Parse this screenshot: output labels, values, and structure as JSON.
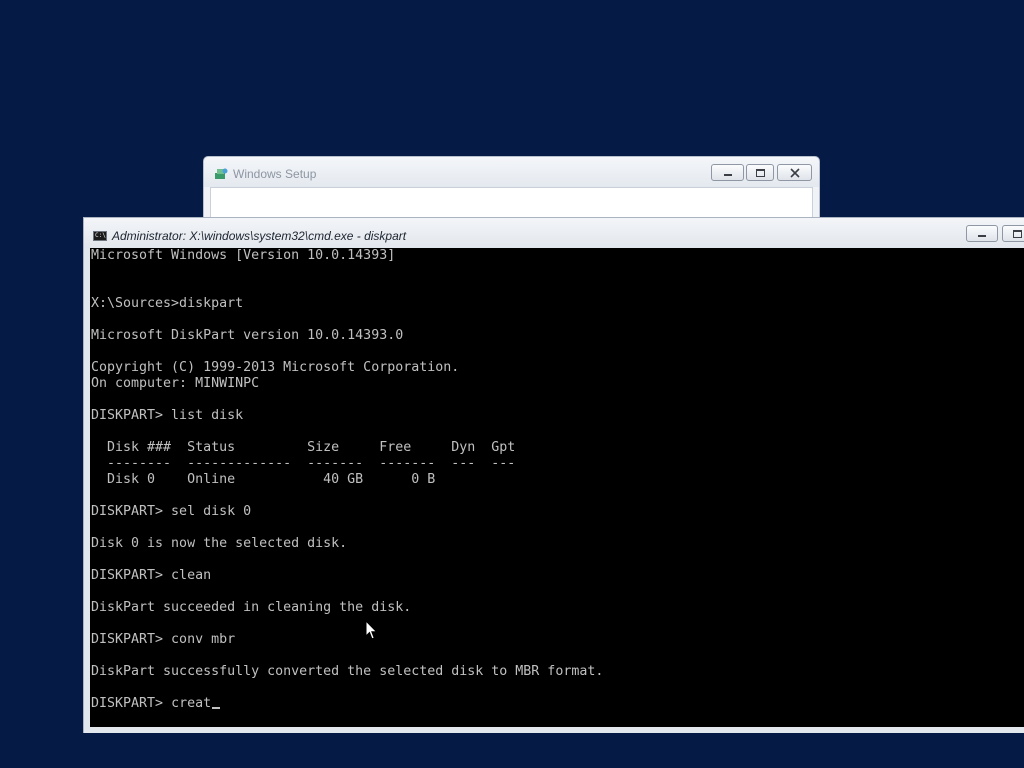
{
  "setup_window": {
    "title": "Windows Setup",
    "icon": "setup-disc-icon",
    "buttons": [
      "minimize-icon",
      "maximize-icon",
      "close-icon"
    ]
  },
  "cmd_window": {
    "title": "Administrator: X:\\windows\\system32\\cmd.exe - diskpart",
    "icon_text": "C:\\",
    "icon": "console-icon",
    "buttons": [
      "minimize-icon",
      "maximize-icon"
    ]
  },
  "console": {
    "lines": [
      "Microsoft Windows [Version 10.0.14393]",
      "",
      "",
      "X:\\Sources>diskpart",
      "",
      "Microsoft DiskPart version 10.0.14393.0",
      "",
      "Copyright (C) 1999-2013 Microsoft Corporation.",
      "On computer: MINWINPC",
      "",
      "DISKPART> list disk",
      "",
      "  Disk ###  Status         Size     Free     Dyn  Gpt",
      "  --------  -------------  -------  -------  ---  ---",
      "  Disk 0    Online           40 GB      0 B",
      "",
      "DISKPART> sel disk 0",
      "",
      "Disk 0 is now the selected disk.",
      "",
      "DISKPART> clean",
      "",
      "DiskPart succeeded in cleaning the disk.",
      "",
      "DISKPART> conv mbr",
      "",
      "DiskPart successfully converted the selected disk to MBR format.",
      ""
    ],
    "prompt": "DISKPART> ",
    "current_input": "creat"
  },
  "colors": {
    "desktop": "#051a45",
    "console_bg": "#000000",
    "console_text": "#c0c0c0"
  }
}
